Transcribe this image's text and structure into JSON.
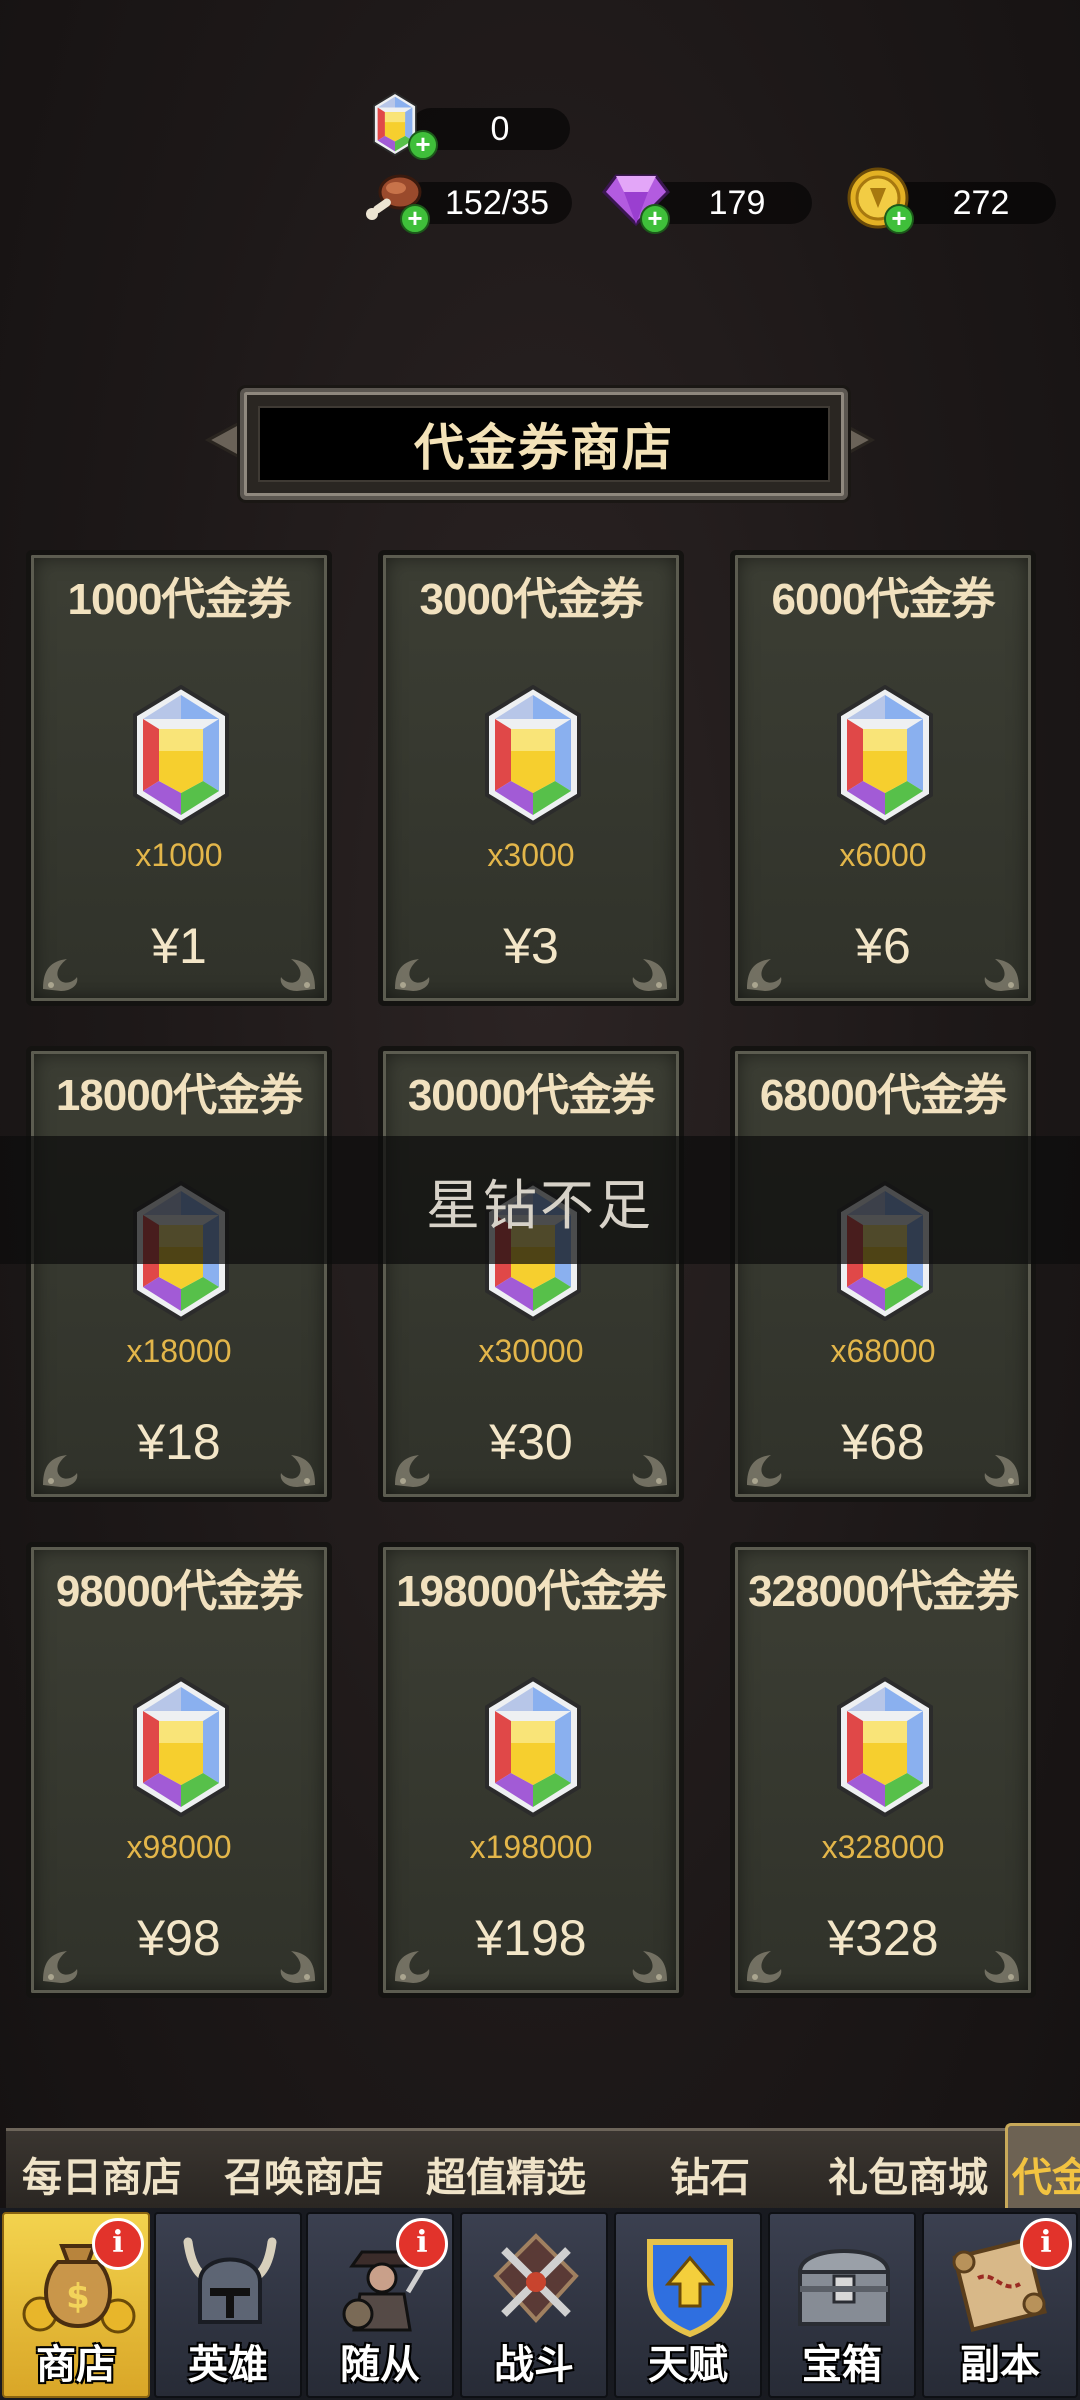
{
  "resources": {
    "voucher": {
      "value": "0",
      "icon": "voucher-gem-icon"
    },
    "food": {
      "value": "152/35",
      "icon": "meat-icon"
    },
    "diamond": {
      "value": "179",
      "icon": "purple-diamond-icon"
    },
    "gold": {
      "value": "272",
      "icon": "gold-coin-icon"
    }
  },
  "title": "代金券商店",
  "cards": [
    {
      "title": "1000代金券",
      "qty": "x1000",
      "price": "¥1"
    },
    {
      "title": "3000代金券",
      "qty": "x3000",
      "price": "¥3"
    },
    {
      "title": "6000代金券",
      "qty": "x6000",
      "price": "¥6"
    },
    {
      "title": "18000代金券",
      "qty": "x18000",
      "price": "¥18"
    },
    {
      "title": "30000代金券",
      "qty": "x30000",
      "price": "¥30"
    },
    {
      "title": "68000代金券",
      "qty": "x68000",
      "price": "¥68"
    },
    {
      "title": "98000代金券",
      "qty": "x98000",
      "price": "¥98"
    },
    {
      "title": "198000代金券",
      "qty": "x198000",
      "price": "¥198"
    },
    {
      "title": "328000代金券",
      "qty": "x328000",
      "price": "¥328"
    }
  ],
  "toast": "星钻不足",
  "shop_tabs": [
    "每日商店",
    "召唤商店",
    "超值精选",
    "钻石",
    "礼包商城",
    "代金"
  ],
  "nav": [
    {
      "label": "商店",
      "icon": "money-bag-icon",
      "badge": "i"
    },
    {
      "label": "英雄",
      "icon": "horned-helmet-icon",
      "badge": ""
    },
    {
      "label": "随从",
      "icon": "follower-icon",
      "badge": "i"
    },
    {
      "label": "战斗",
      "icon": "crossed-swords-icon",
      "badge": ""
    },
    {
      "label": "天赋",
      "icon": "talent-shield-icon",
      "badge": ""
    },
    {
      "label": "宝箱",
      "icon": "treasure-chest-icon",
      "badge": ""
    },
    {
      "label": "副本",
      "icon": "scroll-map-icon",
      "badge": "i"
    }
  ],
  "colors": {
    "accent": "#f2c341",
    "qty": "#e3b64a",
    "badge": "#e2332b"
  }
}
